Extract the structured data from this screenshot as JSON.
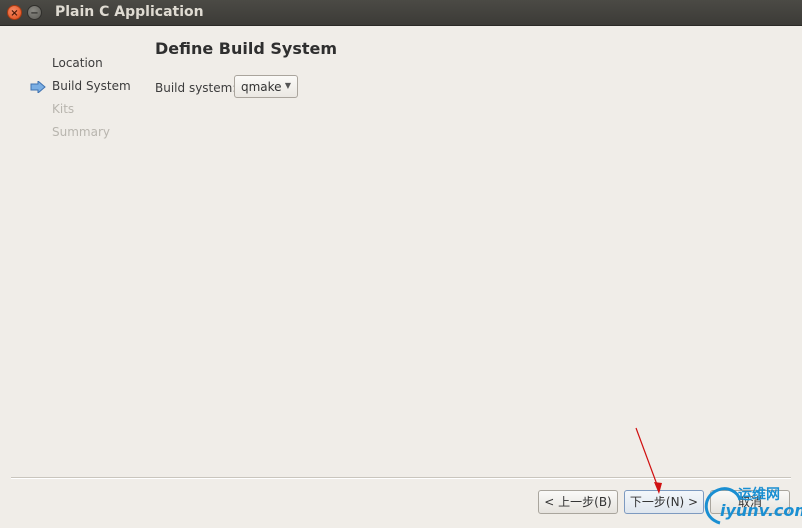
{
  "window": {
    "title": "Plain C Application",
    "close_glyph": "×",
    "min_glyph": "−"
  },
  "sidebar": {
    "current_icon": "arrow-right-icon",
    "steps": [
      {
        "label": "Location",
        "state": "done"
      },
      {
        "label": "Build System",
        "state": "current"
      },
      {
        "label": "Kits",
        "state": "disabled"
      },
      {
        "label": "Summary",
        "state": "disabled"
      }
    ]
  },
  "page": {
    "title": "Define Build System",
    "build_system_label": "Build system:",
    "build_system_value": "qmake"
  },
  "buttons": {
    "back": "< 上一步(B)",
    "next": "下一步(N) >",
    "cancel": "取消"
  },
  "watermark": {
    "top": "运维网",
    "bottom": "iyunv.com"
  },
  "colors": {
    "arrow": "#4a86c7",
    "annotation": "#d01010",
    "watermark": "#1a8fd2"
  }
}
